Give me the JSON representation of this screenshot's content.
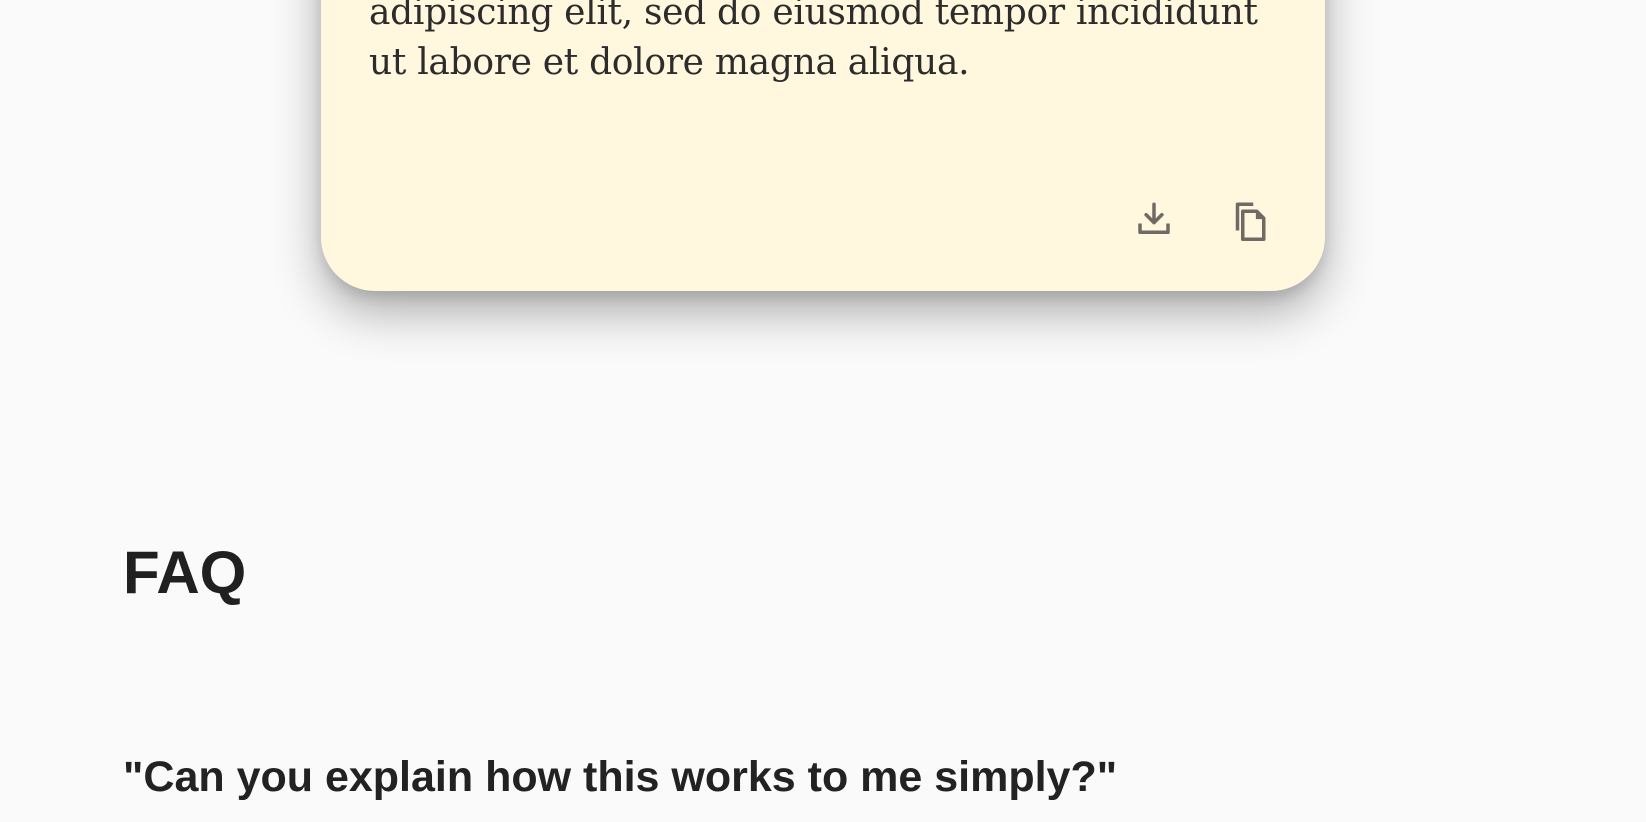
{
  "note_card": {
    "text": "adipiscing elit, sed do eiusmod tempor incididunt ut labore et dolore magna aliqua.",
    "background_color": "#fff8df",
    "actions": [
      {
        "icon": "download-icon"
      },
      {
        "icon": "copy-icon"
      }
    ]
  },
  "faq": {
    "title": "FAQ",
    "questions": [
      {
        "text": "\"Can you explain how this works to me simply?\""
      }
    ]
  }
}
